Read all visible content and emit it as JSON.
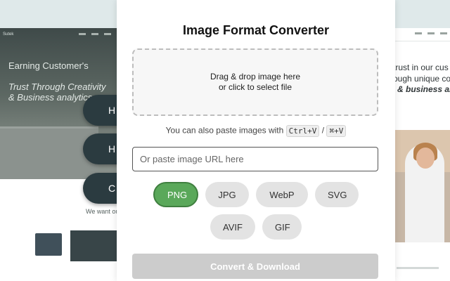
{
  "background_page": {
    "left": {
      "logo": "Sutek",
      "headline_line1": "Earning Customer's",
      "headline_line2": "Trust Through Creativity & Business analytics",
      "pills": [
        "H",
        "H",
        "C"
      ],
      "section_text": "We want ou"
    },
    "right": {
      "headline_line1": "trust in our cus",
      "headline_line2": "ough unique co",
      "headline_line3": "& business analy"
    }
  },
  "converter": {
    "title": "Image Format Converter",
    "dropzone": {
      "line1": "Drag & drop image here",
      "line2": "or click to select file"
    },
    "paste_hint": {
      "text": "You can also paste images with",
      "shortcut_win": "Ctrl+V",
      "separator": "/",
      "shortcut_mac": "⌘+V"
    },
    "url_input": {
      "placeholder": "Or paste image URL here",
      "value": ""
    },
    "formats": [
      "PNG",
      "JPG",
      "WebP",
      "SVG",
      "AVIF",
      "GIF"
    ],
    "selected_format": "PNG",
    "convert_button": "Convert & Download"
  },
  "colors": {
    "selected_format_bg": "#5aa85a",
    "format_bg": "#e3e3e3",
    "convert_disabled_bg": "#cccccc",
    "background_teal": "#dfe9ea"
  }
}
